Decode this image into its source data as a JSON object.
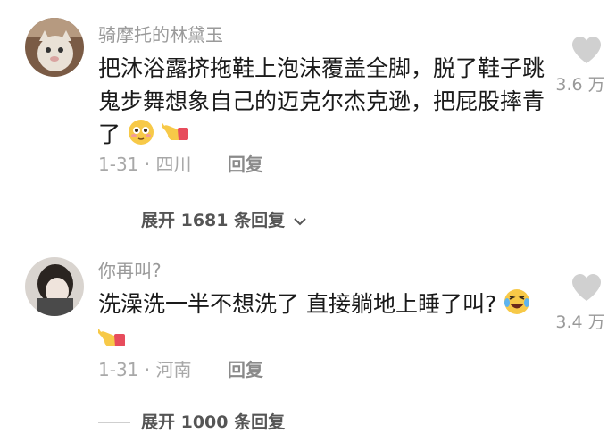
{
  "comments": [
    {
      "username": "骑摩托的林黛玉",
      "text": "把沐浴露挤拖鞋上泡沫覆盖全脚，脱了鞋子跳鬼步舞想象自己的迈克尔杰克逊，把屁股摔青了",
      "emojis": [
        "flushed-face-icon",
        "hand-pointing-icon"
      ],
      "date": "1-31",
      "location": "四川",
      "reply_label": "回复",
      "likes": "3.6 万",
      "expand_label": "展开 1681 条回复"
    },
    {
      "username": "你再叫?",
      "text": "洗澡洗一半不想洗了 直接躺地上睡了叫?",
      "emojis": [
        "laughing-tears-icon",
        "hand-pointing-icon"
      ],
      "date": "1-31",
      "location": "河南",
      "reply_label": "回复",
      "likes": "3.4 万",
      "expand_label": "展开 1000 条回复"
    }
  ],
  "colors": {
    "text": "#1a1a1a",
    "muted": "#9a9a9a",
    "heart": "#cfcfcf",
    "emoji_yellow": "#f7c948"
  }
}
